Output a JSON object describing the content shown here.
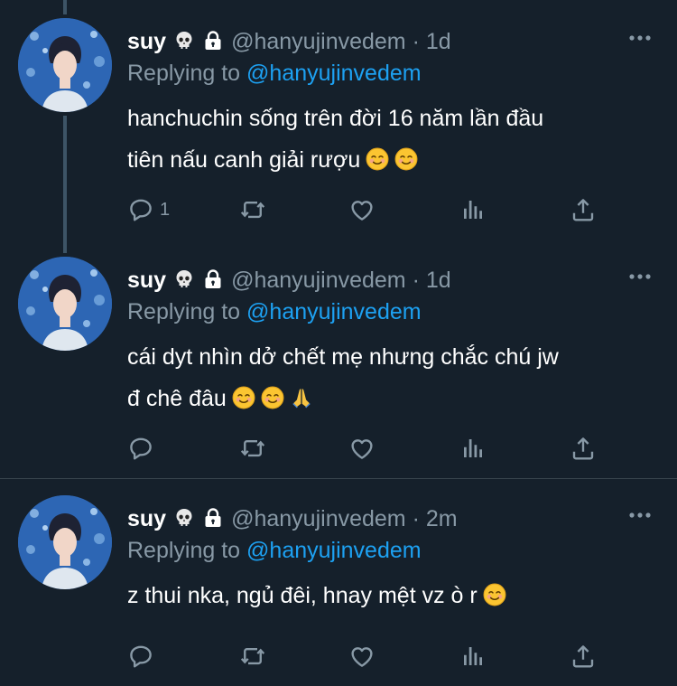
{
  "colors": {
    "background": "#15202b",
    "text": "#ffffff",
    "muted": "#8899a6",
    "link": "#1da1f2",
    "divider": "#38444d"
  },
  "tweets": [
    {
      "name": "suy",
      "handle": "@hanyujinvedem",
      "dot": "·",
      "time": "1d",
      "reply_prefix": "Replying to",
      "reply_to": "@hanyujinvedem",
      "lines": [
        "hanchuchin sống trên đời 16 năm lần đầu",
        "tiên nấu canh giải rượu"
      ],
      "line2_emojis": [
        "smiling-face-icon",
        "smiling-face-icon"
      ],
      "reply_count": "1"
    },
    {
      "name": "suy",
      "handle": "@hanyujinvedem",
      "dot": "·",
      "time": "1d",
      "reply_prefix": "Replying to",
      "reply_to": "@hanyujinvedem",
      "lines": [
        "cái dyt nhìn dở chết mẹ nhưng chắc chú jw",
        "đ chê đâu"
      ],
      "line2_emojis": [
        "smiling-face-icon",
        "smiling-face-icon",
        "folded-hands-icon"
      ],
      "reply_count": ""
    },
    {
      "name": "suy",
      "handle": "@hanyujinvedem",
      "dot": "·",
      "time": "2m",
      "reply_prefix": "Replying to",
      "reply_to": "@hanyujinvedem",
      "lines": [
        "z thui nka, ngủ đêi, hnay mệt vz ò r"
      ],
      "line1_emojis": [
        "smiling-face-icon"
      ],
      "reply_count": ""
    }
  ]
}
